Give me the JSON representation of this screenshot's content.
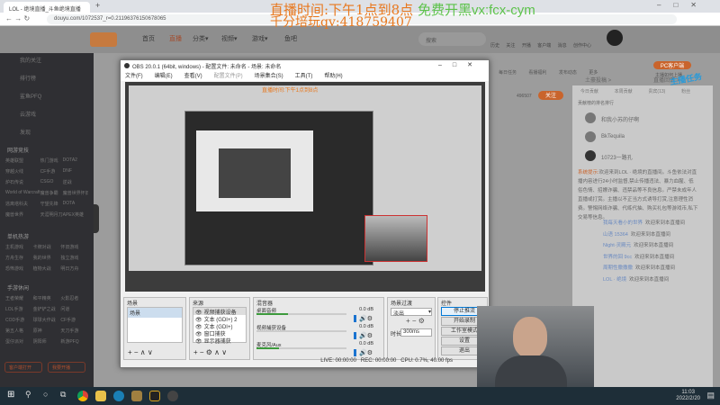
{
  "browser": {
    "tab_title": "LOL - 绝境直播_斗鱼绝境直播",
    "url": "douyu.com/1072537_r=0.21196376150678065"
  },
  "overlay": {
    "line1": "直播时间:下午1点到8点",
    "line1_green": "免费开黑vx:fcx-cym",
    "line2": "千分培玩qv:418759407"
  },
  "site_nav": [
    "首页",
    "直播",
    "分类▾",
    "视频▾",
    "游戏▾",
    "鱼吧"
  ],
  "site_search_placeholder": "搜索",
  "header_icons": [
    "历史",
    "关注",
    "开播",
    "客户端",
    "消息",
    "创作中心"
  ],
  "sidebar": {
    "items": [
      "我的关注",
      "排行榜",
      "鲨鱼PFQ",
      "云游戏",
      "发现"
    ],
    "section1": "网游竞技",
    "section1_grid": [
      "英雄联盟",
      "热门游戏",
      "DOTA2",
      "穿越火线",
      "CF手游",
      "DNF",
      "炉石传说",
      "CSGO",
      "逆战",
      "World of Warcraft",
      "魔兽争霸",
      "魔兽世界怀旧",
      "逃离塔科夫",
      "守望先锋",
      "DOTA",
      "魔兽世界",
      "天涯明月刀",
      "APEX英雄"
    ],
    "section2": "单机热游",
    "section2_grid": [
      "主机游戏",
      "卡牌对战",
      "怀旧游戏",
      "方舟生存",
      "我的世界",
      "独立游戏",
      "恐怖游戏",
      "植物大战",
      "明日方舟"
    ],
    "section3": "手游休闲",
    "section3_grid": [
      "王者荣耀",
      "和平精英",
      "火影忍者",
      "LOL手游",
      "金铲铲之战",
      "问道",
      "COD手游",
      "球球大作战",
      "CF手游",
      "第五人格",
      "原神",
      "天刀手游",
      "蛋仔派对",
      "阴阳师",
      "新游PFQ"
    ],
    "btn_download": "客户端打开",
    "btn_live": "我要开播"
  },
  "room": {
    "top_icons": [
      "每日任务",
      "看播福利",
      "发布动态",
      "更多"
    ],
    "pc_btn": "PC客户端",
    "pc_sub": "主播如何上播",
    "follow": "关注",
    "follower_count": "496507",
    "share": "分享",
    "tabs": [
      "今日贡献",
      "本周贡献",
      "贵宾(13)",
      "粉丝"
    ],
    "rank_title": "贡献榜的排名排行",
    "rank": [
      "和我小苏的仔啊",
      "BkTequila",
      "10723一路孔"
    ],
    "badge": "主播任务",
    "sponsor": "土豪投稿 >",
    "gift": "直播回馈 >"
  },
  "chat": {
    "system_label": "系统提示:",
    "system_text": "欢迎来到LOL · 绝境的直播间。斗鱼依法对直播内容进行24小时监督,禁止传播违法、暴力血腥、低俗色情、招嫖诈骗、违禁品等不良信息。严禁未成年人直播或打赏。主播以不正当方式诱导打赏,注意理性消费。警惕网络诈骗、代练代抽、购买礼包等游戏币,私下交易等信息。",
    "messages": [
      {
        "user": "我每天看小的世界",
        "text": "欢迎来到本直播间"
      },
      {
        "user": "山语 15364",
        "text": "欢迎来到本直播间"
      },
      {
        "user": "Night·灵殿元",
        "text": "欢迎来到本直播间"
      },
      {
        "user": "世界的回 9cc",
        "text": "欢迎来到本直播间"
      },
      {
        "user": "周期性撒撒撒",
        "text": "欢迎来到本直播间"
      },
      {
        "user": "LOL · 绝境",
        "text": "欢迎来到本直播间"
      }
    ]
  },
  "obs": {
    "title": "OBS 20.0.1 (64bit, windows) - 配置文件: 未命名 - 场景: 未命名",
    "menu": [
      "文件(F)",
      "编辑(E)",
      "查看(V)",
      "配置文件(P)",
      "场景集合(S)",
      "工具(T)",
      "帮助(H)"
    ],
    "docks": {
      "scenes": "场景",
      "sources": "来源",
      "mixer": "混音器",
      "transitions": "场景过渡",
      "controls": "控件"
    },
    "scene_items": [
      "场景"
    ],
    "source_items": [
      "视频捕获设备",
      "文本 (GDI+) 2",
      "文本 (GDI+)",
      "窗口捕获",
      "显示器捕获"
    ],
    "mixer_items": [
      {
        "name": "桌面音频",
        "db": "0.0 dB",
        "level": 0.35
      },
      {
        "name": "视频捕获设备",
        "db": "0.0 dB",
        "level": 0.0
      },
      {
        "name": "麦克风/Aux",
        "db": "0.0 dB",
        "level": 0.25
      }
    ],
    "transition": "淡出",
    "duration_label": "时长",
    "duration": "300ms",
    "controls": [
      "停止推流",
      "开始录制",
      "工作室模式",
      "设置",
      "退出"
    ],
    "status": {
      "live": "LIVE: 00:00:00",
      "rec": "REC: 00:00:00",
      "cpu": "CPU: 0.7%, 40.00 fps"
    }
  },
  "taskbar": {
    "time": "11:03",
    "date": "2022/2/20"
  }
}
